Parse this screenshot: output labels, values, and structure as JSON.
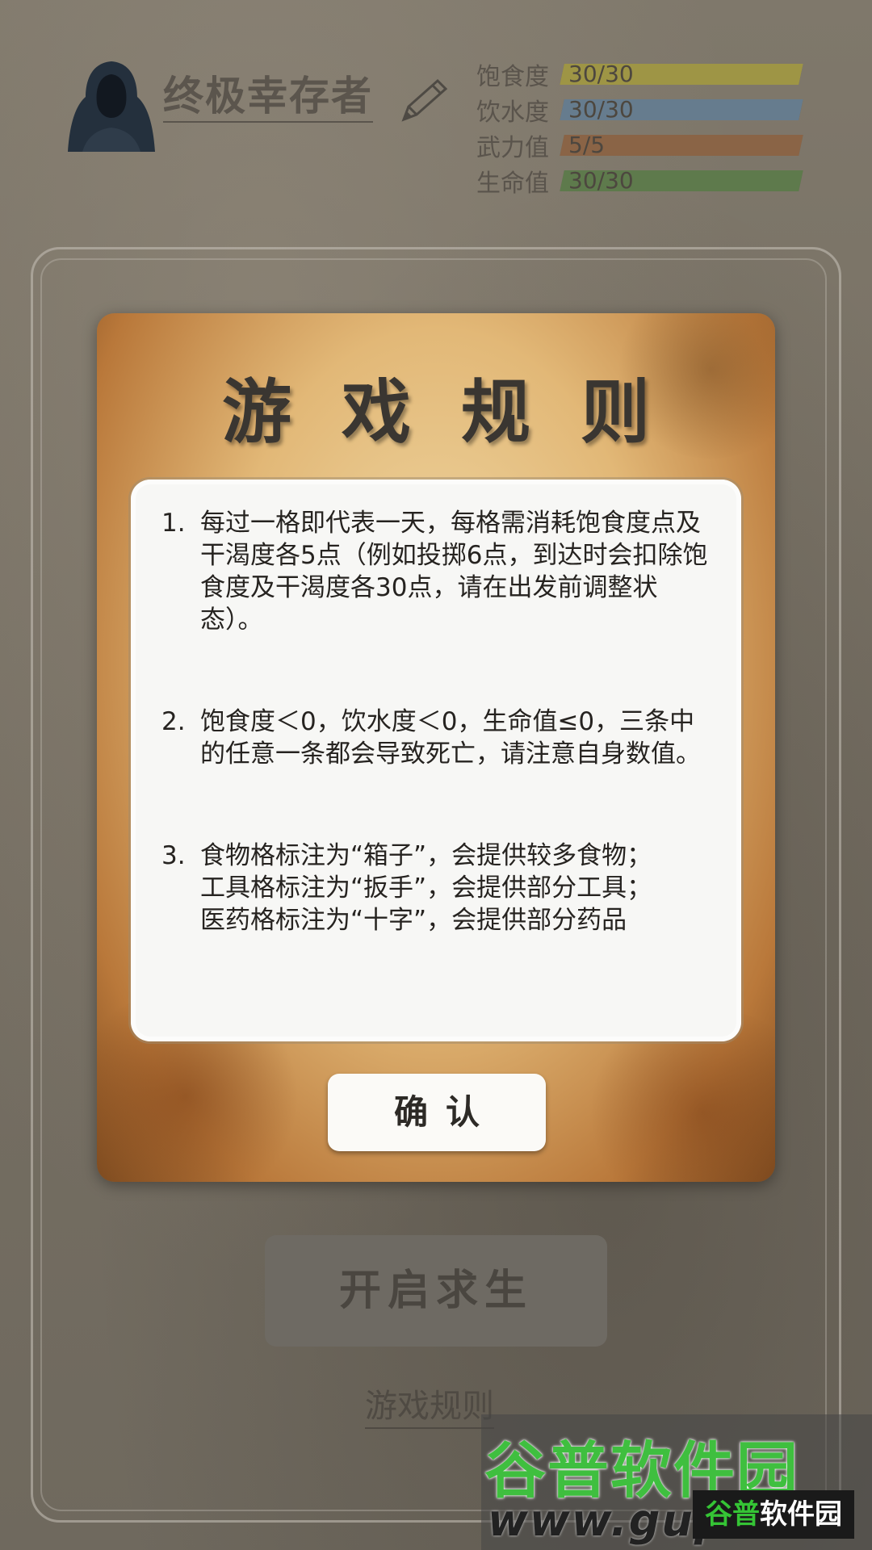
{
  "player": {
    "name": "终极幸存者"
  },
  "stats": [
    {
      "label": "饱食度",
      "value": "30/30",
      "fraction": 1.0,
      "color": "#9e9545"
    },
    {
      "label": "饮水度",
      "value": "30/30",
      "fraction": 1.0,
      "color": "#667c8e"
    },
    {
      "label": "武力值",
      "value": "5/5",
      "fraction": 1.0,
      "color": "#8a6446"
    },
    {
      "label": "生命值",
      "value": "30/30",
      "fraction": 1.0,
      "color": "#5e7a4c"
    }
  ],
  "dialog": {
    "title": "游戏规则",
    "rules": [
      {
        "num": "1.",
        "text": "每过一格即代表一天，每格需消耗饱食度点及干渴度各5点（例如投掷6点，到达时会扣除饱食度及干渴度各30点，请在出发前调整状态）。"
      },
      {
        "num": "2.",
        "text": "饱食度＜0，饮水度＜0，生命值≤0，三条中的任意一条都会导致死亡，请注意自身数值。"
      },
      {
        "num": "3.",
        "text": "食物格标注为“箱子”，会提供较多食物；\n工具格标注为“扳手”，会提供部分工具；\n医药格标注为“十字”，会提供部分药品"
      }
    ],
    "confirm_label": "确认"
  },
  "start_button": {
    "label": "开启求生"
  },
  "rules_link": {
    "label": "游戏规则"
  },
  "watermark": {
    "brand": "谷普软件园",
    "url": "www.gupux",
    "badge_a": "谷普",
    "badge_b": "软件园"
  }
}
